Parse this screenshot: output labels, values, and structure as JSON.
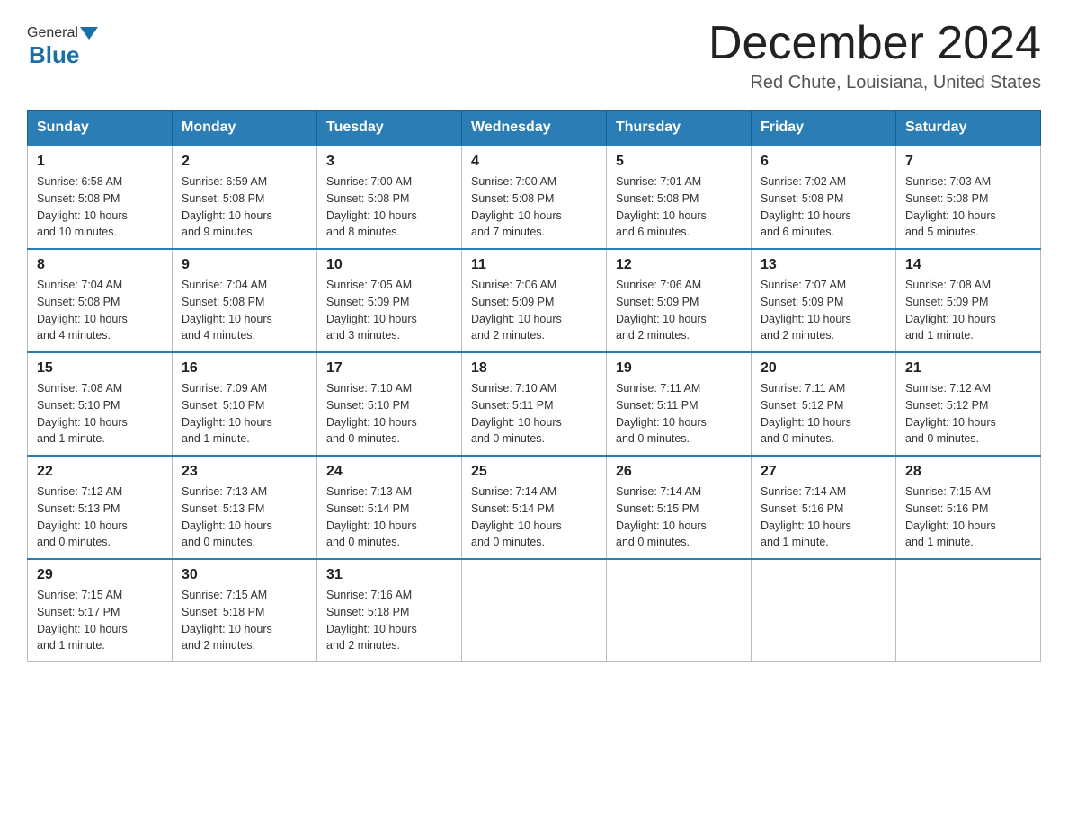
{
  "header": {
    "title": "December 2024",
    "location": "Red Chute, Louisiana, United States",
    "logo_general": "General",
    "logo_blue": "Blue"
  },
  "weekdays": [
    "Sunday",
    "Monday",
    "Tuesday",
    "Wednesday",
    "Thursday",
    "Friday",
    "Saturday"
  ],
  "weeks": [
    [
      {
        "day": "1",
        "sunrise": "6:58 AM",
        "sunset": "5:08 PM",
        "daylight": "10 hours and 10 minutes."
      },
      {
        "day": "2",
        "sunrise": "6:59 AM",
        "sunset": "5:08 PM",
        "daylight": "10 hours and 9 minutes."
      },
      {
        "day": "3",
        "sunrise": "7:00 AM",
        "sunset": "5:08 PM",
        "daylight": "10 hours and 8 minutes."
      },
      {
        "day": "4",
        "sunrise": "7:00 AM",
        "sunset": "5:08 PM",
        "daylight": "10 hours and 7 minutes."
      },
      {
        "day": "5",
        "sunrise": "7:01 AM",
        "sunset": "5:08 PM",
        "daylight": "10 hours and 6 minutes."
      },
      {
        "day": "6",
        "sunrise": "7:02 AM",
        "sunset": "5:08 PM",
        "daylight": "10 hours and 6 minutes."
      },
      {
        "day": "7",
        "sunrise": "7:03 AM",
        "sunset": "5:08 PM",
        "daylight": "10 hours and 5 minutes."
      }
    ],
    [
      {
        "day": "8",
        "sunrise": "7:04 AM",
        "sunset": "5:08 PM",
        "daylight": "10 hours and 4 minutes."
      },
      {
        "day": "9",
        "sunrise": "7:04 AM",
        "sunset": "5:08 PM",
        "daylight": "10 hours and 4 minutes."
      },
      {
        "day": "10",
        "sunrise": "7:05 AM",
        "sunset": "5:09 PM",
        "daylight": "10 hours and 3 minutes."
      },
      {
        "day": "11",
        "sunrise": "7:06 AM",
        "sunset": "5:09 PM",
        "daylight": "10 hours and 2 minutes."
      },
      {
        "day": "12",
        "sunrise": "7:06 AM",
        "sunset": "5:09 PM",
        "daylight": "10 hours and 2 minutes."
      },
      {
        "day": "13",
        "sunrise": "7:07 AM",
        "sunset": "5:09 PM",
        "daylight": "10 hours and 2 minutes."
      },
      {
        "day": "14",
        "sunrise": "7:08 AM",
        "sunset": "5:09 PM",
        "daylight": "10 hours and 1 minute."
      }
    ],
    [
      {
        "day": "15",
        "sunrise": "7:08 AM",
        "sunset": "5:10 PM",
        "daylight": "10 hours and 1 minute."
      },
      {
        "day": "16",
        "sunrise": "7:09 AM",
        "sunset": "5:10 PM",
        "daylight": "10 hours and 1 minute."
      },
      {
        "day": "17",
        "sunrise": "7:10 AM",
        "sunset": "5:10 PM",
        "daylight": "10 hours and 0 minutes."
      },
      {
        "day": "18",
        "sunrise": "7:10 AM",
        "sunset": "5:11 PM",
        "daylight": "10 hours and 0 minutes."
      },
      {
        "day": "19",
        "sunrise": "7:11 AM",
        "sunset": "5:11 PM",
        "daylight": "10 hours and 0 minutes."
      },
      {
        "day": "20",
        "sunrise": "7:11 AM",
        "sunset": "5:12 PM",
        "daylight": "10 hours and 0 minutes."
      },
      {
        "day": "21",
        "sunrise": "7:12 AM",
        "sunset": "5:12 PM",
        "daylight": "10 hours and 0 minutes."
      }
    ],
    [
      {
        "day": "22",
        "sunrise": "7:12 AM",
        "sunset": "5:13 PM",
        "daylight": "10 hours and 0 minutes."
      },
      {
        "day": "23",
        "sunrise": "7:13 AM",
        "sunset": "5:13 PM",
        "daylight": "10 hours and 0 minutes."
      },
      {
        "day": "24",
        "sunrise": "7:13 AM",
        "sunset": "5:14 PM",
        "daylight": "10 hours and 0 minutes."
      },
      {
        "day": "25",
        "sunrise": "7:14 AM",
        "sunset": "5:14 PM",
        "daylight": "10 hours and 0 minutes."
      },
      {
        "day": "26",
        "sunrise": "7:14 AM",
        "sunset": "5:15 PM",
        "daylight": "10 hours and 0 minutes."
      },
      {
        "day": "27",
        "sunrise": "7:14 AM",
        "sunset": "5:16 PM",
        "daylight": "10 hours and 1 minute."
      },
      {
        "day": "28",
        "sunrise": "7:15 AM",
        "sunset": "5:16 PM",
        "daylight": "10 hours and 1 minute."
      }
    ],
    [
      {
        "day": "29",
        "sunrise": "7:15 AM",
        "sunset": "5:17 PM",
        "daylight": "10 hours and 1 minute."
      },
      {
        "day": "30",
        "sunrise": "7:15 AM",
        "sunset": "5:18 PM",
        "daylight": "10 hours and 2 minutes."
      },
      {
        "day": "31",
        "sunrise": "7:16 AM",
        "sunset": "5:18 PM",
        "daylight": "10 hours and 2 minutes."
      },
      null,
      null,
      null,
      null
    ]
  ],
  "labels": {
    "sunrise": "Sunrise:",
    "sunset": "Sunset:",
    "daylight": "Daylight:"
  }
}
